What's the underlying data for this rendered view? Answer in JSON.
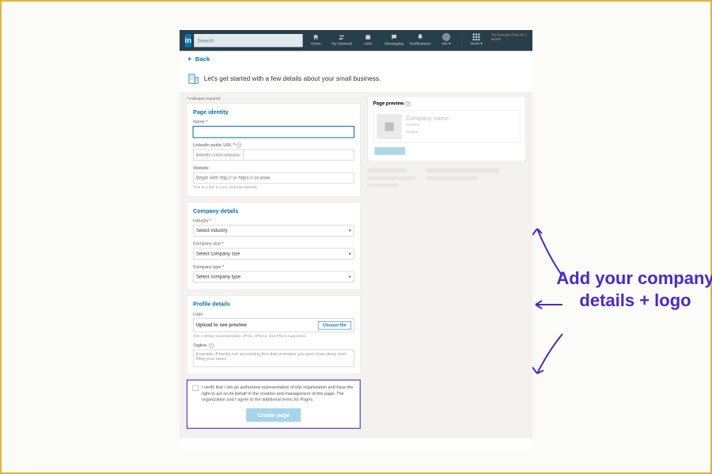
{
  "nav": {
    "search_placeholder": "Search",
    "items": {
      "home": "Home",
      "network": "My Network",
      "jobs": "Jobs",
      "messaging": "Messaging",
      "notifications": "Notifications",
      "me": "Me ▾",
      "work": "Work ▾"
    },
    "promo": "Try Premium Free for 1 Month"
  },
  "back_label": "Back",
  "intro_text": "Let's get started with a few details about your small business.",
  "required_note": "* indicates required",
  "identity": {
    "title": "Page identity",
    "name_label": "Name",
    "url_label": "LinkedIn public URL",
    "url_prefix": "linkedin.com/company/",
    "website_label": "Website",
    "website_placeholder": "Begin with http:// or https:// or www.",
    "website_hint": "This is a link to your external website."
  },
  "details": {
    "title": "Company details",
    "industry_label": "Industry",
    "industry_value": "Select industry",
    "size_label": "Company size",
    "size_value": "Select company size",
    "type_label": "Company type",
    "type_value": "Select company type"
  },
  "profile": {
    "title": "Profile details",
    "logo_label": "Logo",
    "upload_text": "Upload to see preview",
    "choose_label": "Choose file",
    "upload_hint": "300 x 300px recommended. JPGs, JPEGs, and PNGs supported.",
    "tagline_label": "Tagline",
    "tagline_placeholder": "Example: A family-run accounting firm that promises you won't lose sleep over filing your taxes."
  },
  "verify": {
    "text_a": "I verify that I am an authorized representative of this organization and have the right to act on its behalf in the creation and management of this page. The organization and I agree to the additional ",
    "terms": "terms",
    "text_b": " for Pages.",
    "create_label": "Create page"
  },
  "preview": {
    "title": "Page preview",
    "company": "Company name",
    "industry": "Industry",
    "tagline": "Tagline"
  },
  "annotation": "Add your company details + logo"
}
